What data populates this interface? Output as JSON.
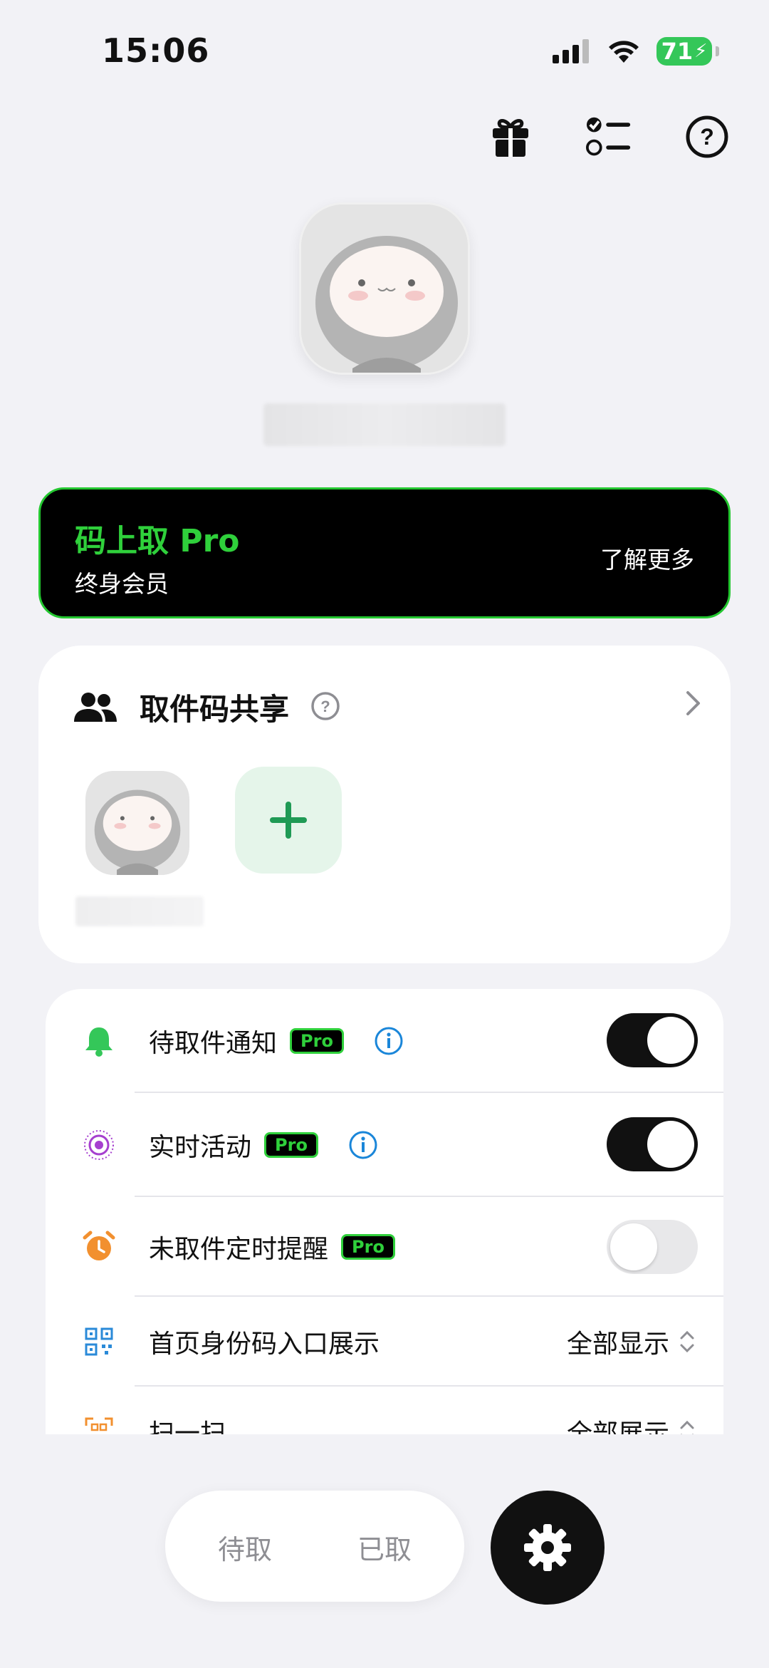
{
  "status_bar": {
    "time": "15:06",
    "battery": "71"
  },
  "header_icons": [
    "gift-icon",
    "checklist-icon",
    "help-icon"
  ],
  "profile": {
    "name": ""
  },
  "pro_banner": {
    "title": "码上取 Pro",
    "subtitle": "终身会员",
    "action": "了解更多"
  },
  "share": {
    "title": "取件码共享",
    "members": [
      {
        "name": ""
      }
    ]
  },
  "settings": {
    "pro_badge": "Pro",
    "rows": [
      {
        "label": "待取件通知",
        "pro": true,
        "info": true,
        "toggle": true
      },
      {
        "label": "实时活动",
        "pro": true,
        "info": true,
        "toggle": true
      },
      {
        "label": "未取件定时提醒",
        "pro": true,
        "info": false,
        "toggle": false
      },
      {
        "label": "首页身份码入口展示",
        "value": "全部显示"
      },
      {
        "label": "扫一扫",
        "value": "全部展示"
      }
    ]
  },
  "bottom_nav": {
    "tabs": [
      "待取",
      "已取"
    ]
  },
  "colors": {
    "accent_green": "#2fd03b",
    "bell_green": "#34c759",
    "alarm_orange": "#f2902f",
    "live_purple": "#a63fcf",
    "info_blue": "#1a86d9",
    "qr_blue": "#2a8ad8"
  }
}
